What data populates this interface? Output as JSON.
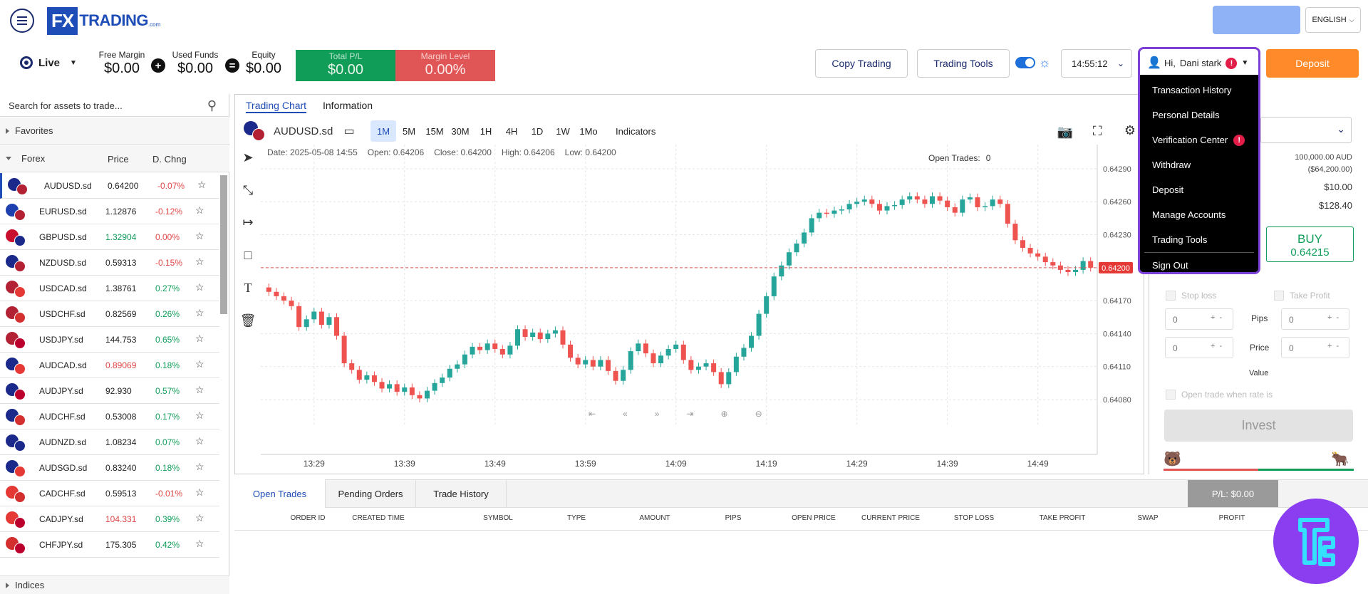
{
  "brand": {
    "logo_fx": "FX",
    "logo_name": "TRADING",
    "logo_suffix": ".com"
  },
  "header": {
    "language": "ENGLISH",
    "colors": {
      "accent_blue": "#1e4db7",
      "deposit_orange": "#ff8a2a",
      "highlight_purple": "#7e3fd6"
    }
  },
  "account": {
    "mode": "Live",
    "free_margin_label": "Free Margin",
    "free_margin": "$0.00",
    "used_funds_label": "Used Funds",
    "used_funds": "$0.00",
    "equity_label": "Equity",
    "equity": "$0.00",
    "total_pl_label": "Total P/L",
    "total_pl": "$0.00",
    "margin_level_label": "Margin Level",
    "margin_level": "0.00%"
  },
  "toolbar": {
    "copy_trading": "Copy Trading",
    "trading_tools": "Trading Tools",
    "time": "14:55:12",
    "greeting": "Hi,",
    "user_name": "Dani  stark",
    "deposit": "Deposit"
  },
  "user_menu": {
    "items": [
      "Transaction History",
      "Personal Details",
      "Verification Center",
      "Withdraw",
      "Deposit",
      "Manage Accounts",
      "Trading Tools",
      "Sign Out"
    ]
  },
  "sidebar": {
    "search_placeholder": "Search for assets to trade...",
    "favorites": "Favorites",
    "forex": "Forex",
    "col_price": "Price",
    "col_change": "D. Chng",
    "indices": "Indices",
    "assets": [
      {
        "symbol": "AUDUSD.sd",
        "price": "0.64200",
        "change": "-0.07%",
        "price_dir": "flat",
        "change_dir": "down",
        "c1": "#1b2a8a",
        "c2": "#b22234"
      },
      {
        "symbol": "EURUSD.sd",
        "price": "1.12876",
        "change": "-0.12%",
        "price_dir": "flat",
        "change_dir": "down",
        "c1": "#1e40af",
        "c2": "#b22234"
      },
      {
        "symbol": "GBPUSD.sd",
        "price": "1.32904",
        "change": "0.00%",
        "price_dir": "up",
        "change_dir": "down",
        "c1": "#c8102e",
        "c2": "#1b2a8a"
      },
      {
        "symbol": "NZDUSD.sd",
        "price": "0.59313",
        "change": "-0.15%",
        "price_dir": "flat",
        "change_dir": "down",
        "c1": "#1b2a8a",
        "c2": "#b22234"
      },
      {
        "symbol": "USDCAD.sd",
        "price": "1.38761",
        "change": "0.27%",
        "price_dir": "flat",
        "change_dir": "up",
        "c1": "#b22234",
        "c2": "#e53935"
      },
      {
        "symbol": "USDCHF.sd",
        "price": "0.82569",
        "change": "0.26%",
        "price_dir": "flat",
        "change_dir": "up",
        "c1": "#b22234",
        "c2": "#d32f2f"
      },
      {
        "symbol": "USDJPY.sd",
        "price": "144.753",
        "change": "0.65%",
        "price_dir": "flat",
        "change_dir": "up",
        "c1": "#b22234",
        "c2": "#bc002d"
      },
      {
        "symbol": "AUDCAD.sd",
        "price": "0.89069",
        "change": "0.18%",
        "price_dir": "down",
        "change_dir": "up",
        "c1": "#1b2a8a",
        "c2": "#e53935"
      },
      {
        "symbol": "AUDJPY.sd",
        "price": "92.930",
        "change": "0.57%",
        "price_dir": "flat",
        "change_dir": "up",
        "c1": "#1b2a8a",
        "c2": "#bc002d"
      },
      {
        "symbol": "AUDCHF.sd",
        "price": "0.53008",
        "change": "0.17%",
        "price_dir": "flat",
        "change_dir": "up",
        "c1": "#1b2a8a",
        "c2": "#d32f2f"
      },
      {
        "symbol": "AUDNZD.sd",
        "price": "1.08234",
        "change": "0.07%",
        "price_dir": "flat",
        "change_dir": "up",
        "c1": "#1b2a8a",
        "c2": "#1b2a8a"
      },
      {
        "symbol": "AUDSGD.sd",
        "price": "0.83240",
        "change": "0.18%",
        "price_dir": "flat",
        "change_dir": "up",
        "c1": "#1b2a8a",
        "c2": "#e53935"
      },
      {
        "symbol": "CADCHF.sd",
        "price": "0.59513",
        "change": "-0.01%",
        "price_dir": "flat",
        "change_dir": "down",
        "c1": "#e53935",
        "c2": "#d32f2f"
      },
      {
        "symbol": "CADJPY.sd",
        "price": "104.331",
        "change": "0.39%",
        "price_dir": "down",
        "change_dir": "up",
        "c1": "#e53935",
        "c2": "#bc002d"
      },
      {
        "symbol": "CHFJPY.sd",
        "price": "175.305",
        "change": "0.42%",
        "price_dir": "flat",
        "change_dir": "up",
        "c1": "#d32f2f",
        "c2": "#bc002d"
      }
    ]
  },
  "chart": {
    "tabs": [
      "Trading Chart",
      "Information"
    ],
    "symbol": "AUDUSD.sd",
    "timeframes": [
      "1M",
      "5M",
      "15M",
      "30M",
      "1H",
      "4H",
      "1D",
      "1W",
      "1Mo"
    ],
    "active_timeframe": "1M",
    "indicators": "Indicators",
    "info_date": "Date: 2025-05-08 14:55",
    "info_open": "Open: 0.64206",
    "info_close": "Close: 0.64200",
    "info_high": "High: 0.64206",
    "info_low": "Low: 0.64200",
    "open_trades_label": "Open Trades:",
    "open_trades": "0",
    "current_price": "0.64200",
    "y_ticks": [
      "0.64290",
      "0.64260",
      "0.64230",
      "0.64200",
      "0.64170",
      "0.64140",
      "0.64110",
      "0.64080"
    ],
    "x_ticks": [
      "13:29",
      "13:39",
      "13:49",
      "13:59",
      "14:09",
      "14:19",
      "14:29",
      "14:39",
      "14:49"
    ]
  },
  "chart_data": {
    "type": "candlestick",
    "title": "AUDUSD.sd",
    "xlabel": "",
    "ylabel": "",
    "ylim": [
      0.6405,
      0.6431
    ],
    "current_price": 0.642,
    "closes": [
      0.64178,
      0.64174,
      0.6417,
      0.64165,
      0.64146,
      0.64153,
      0.6416,
      0.64148,
      0.64155,
      0.64138,
      0.64113,
      0.64107,
      0.64098,
      0.64102,
      0.64096,
      0.6409,
      0.64094,
      0.64087,
      0.64091,
      0.64084,
      0.64081,
      0.64088,
      0.64095,
      0.641,
      0.64108,
      0.64112,
      0.64121,
      0.64128,
      0.64125,
      0.64131,
      0.64126,
      0.64121,
      0.64129,
      0.64144,
      0.64137,
      0.64141,
      0.64135,
      0.6414,
      0.64143,
      0.6413,
      0.64118,
      0.64112,
      0.64116,
      0.6411,
      0.64116,
      0.64106,
      0.64097,
      0.64107,
      0.64124,
      0.64131,
      0.64122,
      0.64113,
      0.6412,
      0.64126,
      0.6413,
      0.64116,
      0.64107,
      0.6411,
      0.64113,
      0.64105,
      0.64094,
      0.64105,
      0.64119,
      0.64127,
      0.64138,
      0.64158,
      0.64174,
      0.64192,
      0.64202,
      0.64214,
      0.64222,
      0.64232,
      0.64245,
      0.6425,
      0.64249,
      0.64252,
      0.64253,
      0.64258,
      0.6426,
      0.64262,
      0.64258,
      0.64252,
      0.64256,
      0.64257,
      0.64262,
      0.64265,
      0.64262,
      0.64258,
      0.64265,
      0.64261,
      0.64255,
      0.6425,
      0.64262,
      0.64264,
      0.64255,
      0.64256,
      0.64262,
      0.64258,
      0.6424,
      0.64225,
      0.64218,
      0.64213,
      0.6421,
      0.64205,
      0.64202,
      0.64198,
      0.64196,
      0.64198,
      0.64206,
      0.642
    ]
  },
  "order_panel": {
    "account_size": "100,000.00 AUD",
    "account_size_usd": "($64,200.00)",
    "pip_value": "$10.00",
    "margin_value": "$128.40",
    "buy_label": "BUY",
    "buy_price": "0.64215",
    "stop_loss": "Stop loss",
    "take_profit": "Take Profit",
    "pips": "Pips",
    "price": "Price",
    "value": "Value",
    "zero": "0",
    "open_when_rate": "Open trade when rate is",
    "invest": "Invest"
  },
  "bottom": {
    "tabs": [
      "Open Trades",
      "Pending Orders",
      "Trade History"
    ],
    "pl": "P/L: $0.00",
    "columns": [
      "ORDER ID",
      "CREATED TIME",
      "SYMBOL",
      "TYPE",
      "AMOUNT",
      "PIPS",
      "OPEN PRICE",
      "CURRENT PRICE",
      "STOP LOSS",
      "TAKE PROFIT",
      "SWAP",
      "PROFIT"
    ]
  }
}
